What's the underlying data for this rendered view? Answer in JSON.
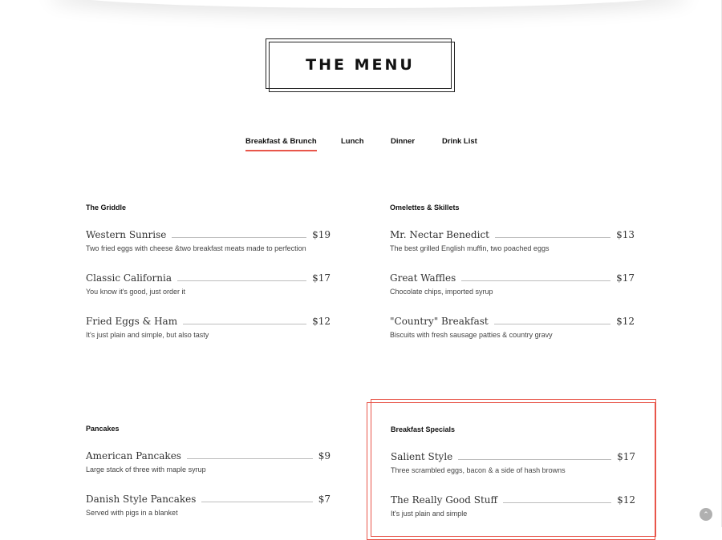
{
  "page_title": "THE MENU",
  "tabs": [
    {
      "label": "Breakfast & Brunch",
      "active": true
    },
    {
      "label": "Lunch",
      "active": false
    },
    {
      "label": "Dinner",
      "active": false
    },
    {
      "label": "Drink List",
      "active": false
    }
  ],
  "sections": {
    "griddle": {
      "title": "The Griddle",
      "items": [
        {
          "name": "Western Sunrise",
          "price": "$19",
          "desc": "Two fried eggs with cheese &two breakfast meats made to perfection"
        },
        {
          "name": "Classic California",
          "price": "$17",
          "desc": "You know it's good, just order it"
        },
        {
          "name": "Fried Eggs & Ham",
          "price": "$12",
          "desc": "It's just plain and simple, but also tasty"
        }
      ]
    },
    "omelettes": {
      "title": "Omelettes & Skillets",
      "items": [
        {
          "name": "Mr. Nectar Benedict",
          "price": "$13",
          "desc": "The best grilled English muffin, two poached eggs"
        },
        {
          "name": "Great Waffles",
          "price": "$17",
          "desc": "Chocolate chips, imported syrup"
        },
        {
          "name": "\"Country\" Breakfast",
          "price": "$12",
          "desc": "Biscuits with fresh sausage patties & country gravy"
        }
      ]
    },
    "pancakes": {
      "title": "Pancakes",
      "items": [
        {
          "name": "American Pancakes",
          "price": "$9",
          "desc": "Large stack of three with maple syrup"
        },
        {
          "name": "Danish Style Pancakes",
          "price": "$7",
          "desc": "Served with pigs in a blanket"
        }
      ]
    },
    "specials": {
      "title": "Breakfast Specials",
      "items": [
        {
          "name": "Salient Style",
          "price": "$17",
          "desc": "Three scrambled eggs, bacon & a side of hash browns"
        },
        {
          "name": "The Really Good Stuff",
          "price": "$12",
          "desc": "It's just plain and simple"
        }
      ]
    }
  },
  "colors": {
    "accent": "#e8564a",
    "text": "#222222",
    "leader": "#bdbdbd"
  },
  "scroll_top_icon": "chevron-up-icon"
}
